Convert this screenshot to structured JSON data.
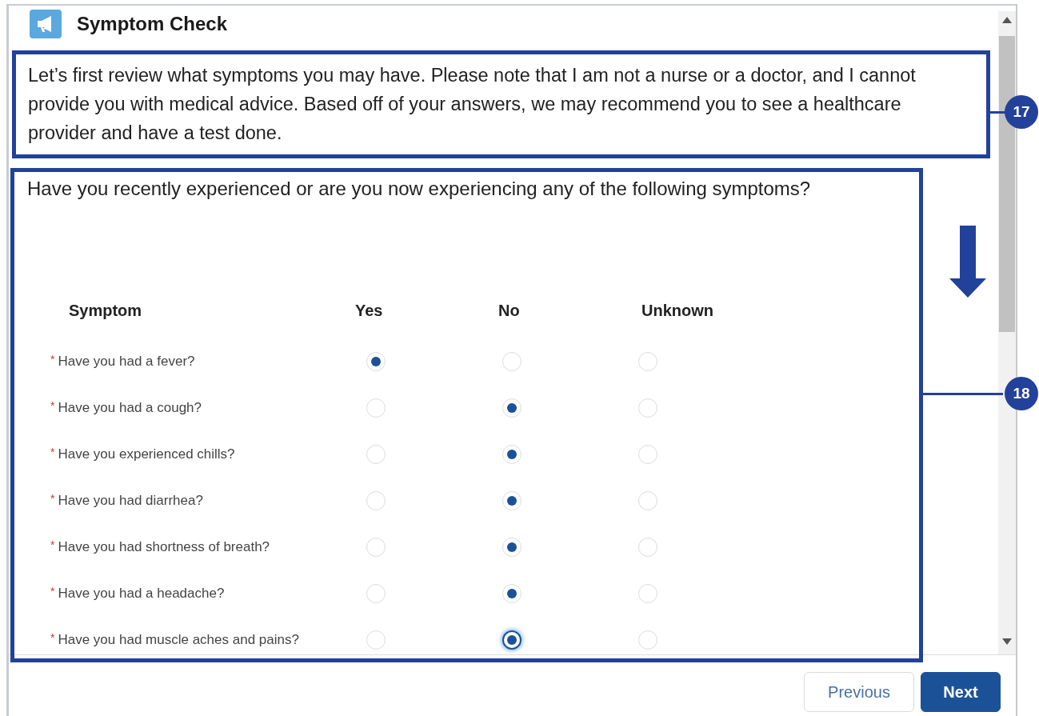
{
  "header": {
    "title": "Symptom Check"
  },
  "intro": "Let’s first review what symptoms you may have. Please note that I am not a nurse or a doctor, and I cannot provide you with medical advice. Based off of your answers, we may recommend you to see a healthcare provider and have a test done.",
  "question": "Have you recently experienced or are you now experiencing any of the following symptoms?",
  "table": {
    "columns": [
      "Symptom",
      "Yes",
      "No",
      "Unknown"
    ],
    "rows": [
      {
        "marker": "*",
        "label": "Have you had a fever?",
        "choices": [
          {
            "selected": true,
            "focused": false
          },
          {
            "selected": false,
            "focused": false
          },
          {
            "selected": false,
            "focused": false
          }
        ]
      },
      {
        "marker": "*",
        "label": "Have you had a cough?",
        "choices": [
          {
            "selected": false,
            "focused": false
          },
          {
            "selected": true,
            "focused": false
          },
          {
            "selected": false,
            "focused": false
          }
        ]
      },
      {
        "marker": "*",
        "label": "Have you experienced chills?",
        "choices": [
          {
            "selected": false,
            "focused": false
          },
          {
            "selected": true,
            "focused": false
          },
          {
            "selected": false,
            "focused": false
          }
        ]
      },
      {
        "marker": "*",
        "label": "Have you had diarrhea?",
        "choices": [
          {
            "selected": false,
            "focused": false
          },
          {
            "selected": true,
            "focused": false
          },
          {
            "selected": false,
            "focused": false
          }
        ]
      },
      {
        "marker": "*",
        "label": "Have you had shortness of breath?",
        "choices": [
          {
            "selected": false,
            "focused": false
          },
          {
            "selected": true,
            "focused": false
          },
          {
            "selected": false,
            "focused": false
          }
        ]
      },
      {
        "marker": "*",
        "label": "Have you had a headache?",
        "choices": [
          {
            "selected": false,
            "focused": false
          },
          {
            "selected": true,
            "focused": false
          },
          {
            "selected": false,
            "focused": false
          }
        ]
      },
      {
        "marker": "*",
        "label": "Have you had muscle aches and pains?",
        "choices": [
          {
            "selected": false,
            "focused": false
          },
          {
            "selected": true,
            "focused": true
          },
          {
            "selected": false,
            "focused": false
          }
        ]
      }
    ]
  },
  "buttons": [
    {
      "label": "Previous",
      "kind": "neutral"
    },
    {
      "label": "Next",
      "kind": "brand"
    }
  ],
  "callouts": [
    {
      "number": "17"
    },
    {
      "number": "18"
    }
  ]
}
